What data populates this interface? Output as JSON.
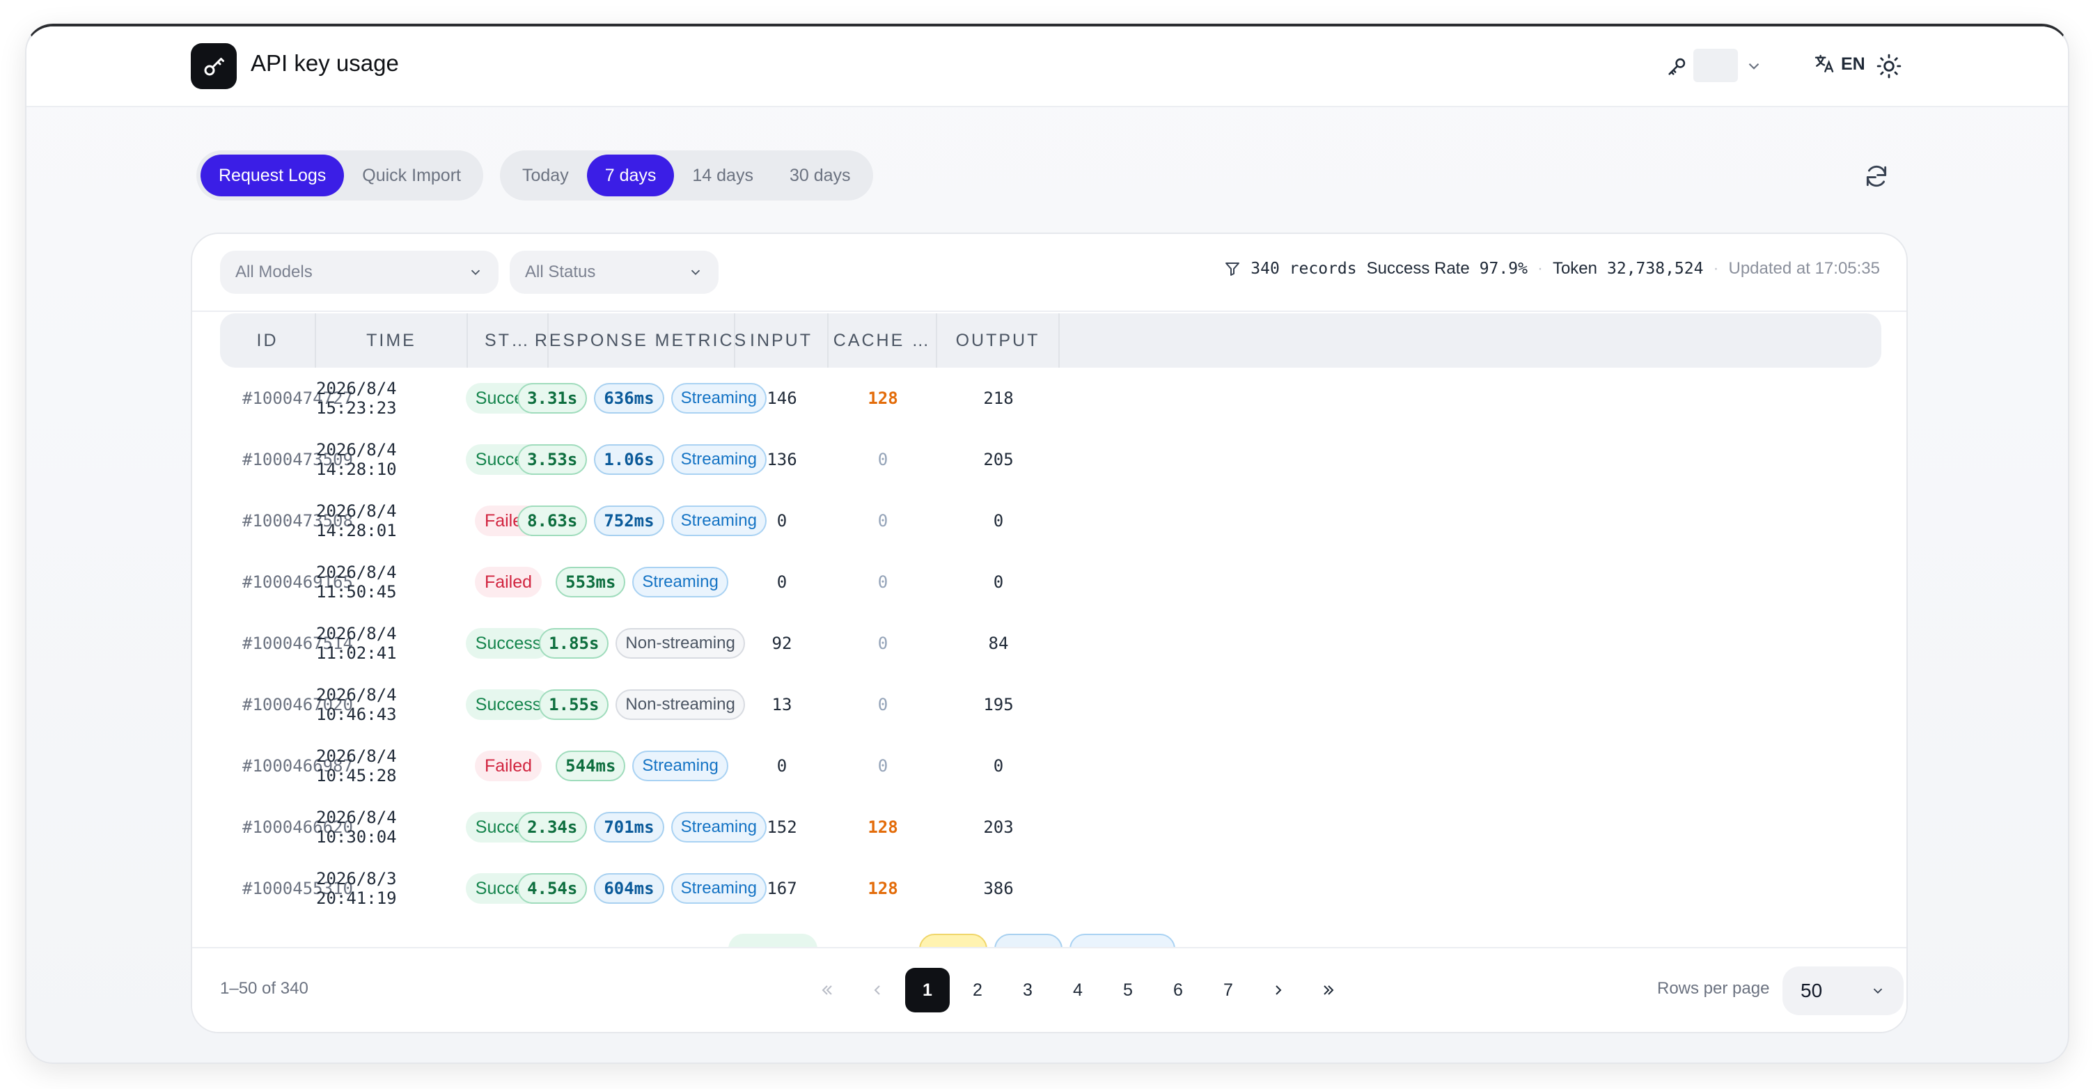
{
  "header": {
    "title": "API key usage",
    "language": "EN"
  },
  "view_tabs": [
    {
      "label": "Request Logs",
      "active": true
    },
    {
      "label": "Quick Import",
      "active": false
    }
  ],
  "range_tabs": [
    {
      "label": "Today",
      "active": false
    },
    {
      "label": "7 days",
      "active": true
    },
    {
      "label": "14 days",
      "active": false
    },
    {
      "label": "30 days",
      "active": false
    }
  ],
  "filters": {
    "model": "All Models",
    "status": "All Status"
  },
  "stats": {
    "records": "340 records",
    "success_label": "Success Rate",
    "success_value": "97.9%",
    "token_label": "Token",
    "token_value": "32,738,524",
    "updated": "Updated at 17:05:35"
  },
  "columns": [
    "ID",
    "TIME",
    "ST…",
    "RESPONSE METRICS",
    "INPUT",
    "CACHE …",
    "OUTPUT"
  ],
  "rows": [
    {
      "id": "#1000474727",
      "time": "2026/8/4 15:23:23",
      "status": "Success",
      "latency": "3.31s",
      "ttfb": "636ms",
      "mode": "Streaming",
      "input": "146",
      "cache": "128",
      "output": "218"
    },
    {
      "id": "#1000473509",
      "time": "2026/8/4 14:28:10",
      "status": "Success",
      "latency": "3.53s",
      "ttfb": "1.06s",
      "mode": "Streaming",
      "input": "136",
      "cache": "0",
      "output": "205"
    },
    {
      "id": "#1000473508",
      "time": "2026/8/4 14:28:01",
      "status": "Failed",
      "latency": "8.63s",
      "ttfb": "752ms",
      "mode": "Streaming",
      "input": "0",
      "cache": "0",
      "output": "0"
    },
    {
      "id": "#1000469165",
      "time": "2026/8/4 11:50:45",
      "status": "Failed",
      "latency": "553ms",
      "ttfb": "",
      "mode": "Streaming",
      "input": "0",
      "cache": "0",
      "output": "0"
    },
    {
      "id": "#1000467514",
      "time": "2026/8/4 11:02:41",
      "status": "Success",
      "latency": "1.85s",
      "ttfb": "",
      "mode": "Non-streaming",
      "input": "92",
      "cache": "0",
      "output": "84"
    },
    {
      "id": "#1000467020",
      "time": "2026/8/4 10:46:43",
      "status": "Success",
      "latency": "1.55s",
      "ttfb": "",
      "mode": "Non-streaming",
      "input": "13",
      "cache": "0",
      "output": "195"
    },
    {
      "id": "#1000466987",
      "time": "2026/8/4 10:45:28",
      "status": "Failed",
      "latency": "544ms",
      "ttfb": "",
      "mode": "Streaming",
      "input": "0",
      "cache": "0",
      "output": "0"
    },
    {
      "id": "#1000466620",
      "time": "2026/8/4 10:30:04",
      "status": "Success",
      "latency": "2.34s",
      "ttfb": "701ms",
      "mode": "Streaming",
      "input": "152",
      "cache": "128",
      "output": "203"
    },
    {
      "id": "#1000455310",
      "time": "2026/8/3 20:41:19",
      "status": "Success",
      "latency": "4.54s",
      "ttfb": "604ms",
      "mode": "Streaming",
      "input": "167",
      "cache": "128",
      "output": "386"
    }
  ],
  "footer": {
    "range": "1–50 of 340",
    "pages": [
      "1",
      "2",
      "3",
      "4",
      "5",
      "6",
      "7"
    ],
    "current_page": "1",
    "rows_per_page_label": "Rows per page",
    "rows_per_page": "50"
  },
  "colors": {
    "accent": "#3b1ee6",
    "success": "#14844c",
    "failed": "#d1243f",
    "cache_hit": "#e36c0a"
  }
}
